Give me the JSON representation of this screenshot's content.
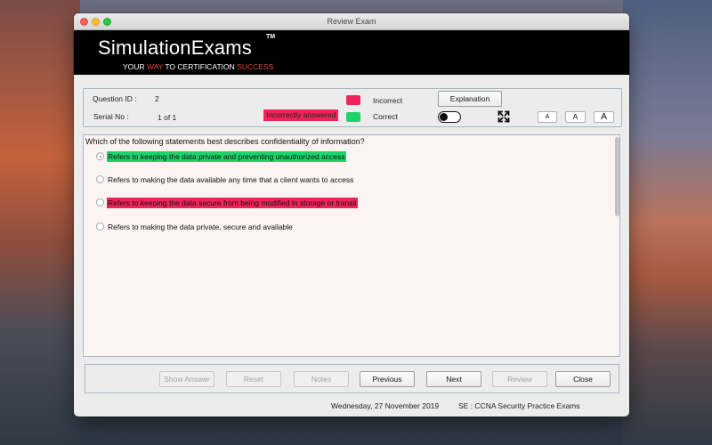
{
  "window": {
    "title": "Review Exam"
  },
  "banner": {
    "brand": "SimulationExams",
    "tm": "TM",
    "tagline": {
      "part1": "YOUR ",
      "way": "WAY",
      "part2": " TO CERTIFICATION ",
      "success": "SUCCESS"
    }
  },
  "info": {
    "question_id_label": "Question ID :",
    "question_id_value": "2",
    "serial_label": "Serial No :",
    "serial_value": "1 of 1",
    "status_badge": "Incorrectly answered",
    "legend_incorrect": "Incorrect",
    "legend_correct": "Correct",
    "explanation_button": "Explanation",
    "font_small": "A",
    "font_medium": "A",
    "font_large": "A",
    "toggle_state": "off"
  },
  "question": {
    "text": "Which of the following statements best describes confidentiality of information?",
    "options": [
      {
        "text": "Refers to keeping the data private and preventing unauthorized access",
        "highlight": "correct"
      },
      {
        "text": "Refers to making the data available any time that a client wants to access",
        "highlight": "none"
      },
      {
        "text": "Refers to keeping the data secure from being modified in storage or transit",
        "highlight": "incorrect"
      },
      {
        "text": "Refers to making the data private, secure and available",
        "highlight": "none"
      }
    ]
  },
  "nav": {
    "show_answer": "Show Answer",
    "reset": "Reset",
    "notes": "Notes",
    "previous": "Previous",
    "next": "Next",
    "review": "Review",
    "close": "Close"
  },
  "footer": {
    "date": "Wednesday, 27 November 2019",
    "exam": "SE : CCNA Security Practice Exams"
  },
  "colors": {
    "incorrect": "#f0245a",
    "correct": "#1dd36a",
    "banner_bg": "#000000",
    "tagline_accent": "#e2463c"
  },
  "icons": [
    "close-icon",
    "minimize-icon",
    "maximize-icon",
    "expand-icon",
    "radio-icon"
  ]
}
